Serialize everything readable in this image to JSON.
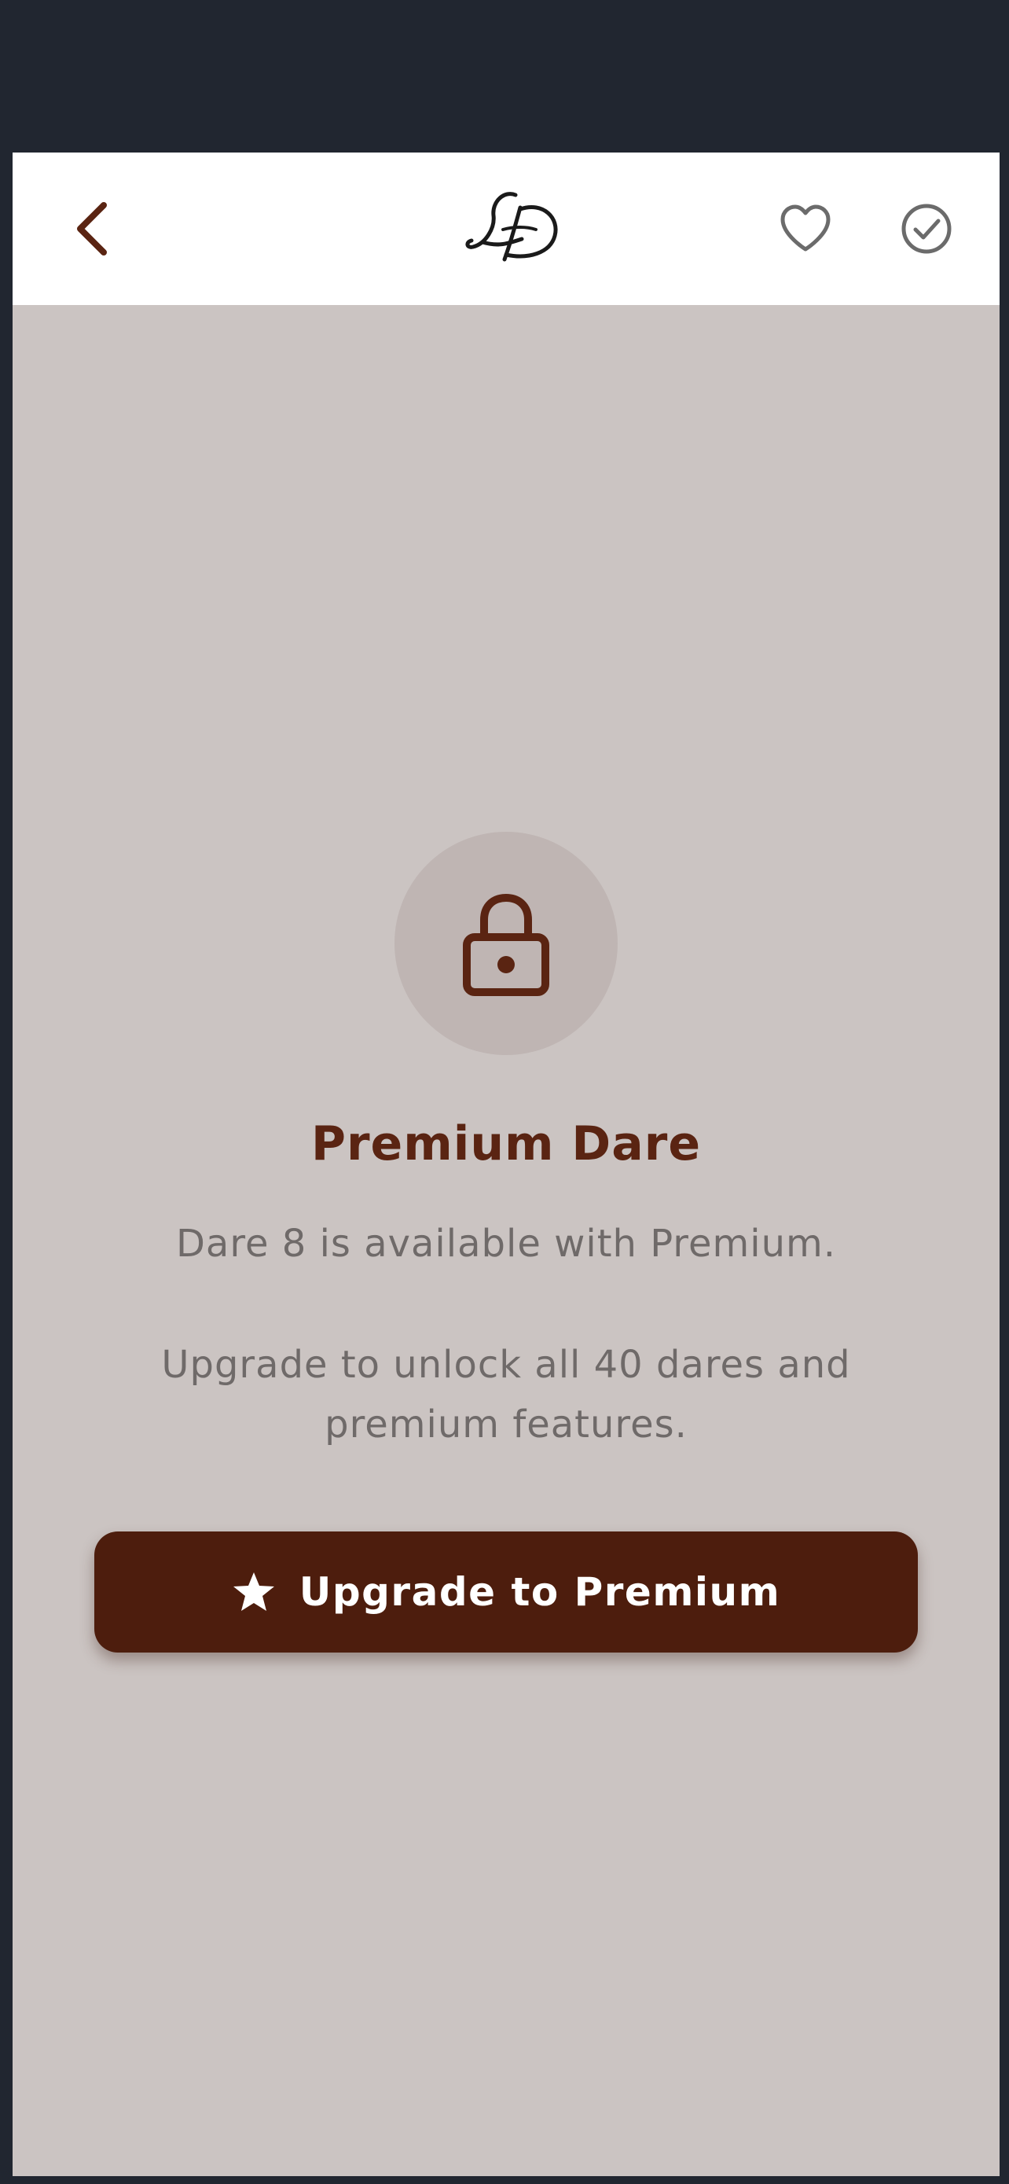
{
  "header": {
    "back_icon": "chevron-left-icon",
    "logo_alt": "LD",
    "favorite_icon": "heart-outline-icon",
    "complete_icon": "check-circle-icon"
  },
  "locked": {
    "icon": "lock-icon",
    "title": "Premium Dare",
    "subtitle": "Dare 8 is available with Premium.",
    "description": "Upgrade to unlock all 40 dares and premium features.",
    "button_icon": "star-icon",
    "button_label": "Upgrade to Premium"
  },
  "colors": {
    "page_background": "#212630",
    "content_background": "#cbc4c2",
    "header_background": "#ffffff",
    "accent_brown": "#5a2412",
    "button_brown": "#4d1d0d",
    "lock_circle": "#bfb5b3",
    "body_text": "#6f6a69",
    "icon_gray": "#6b6b6b"
  }
}
